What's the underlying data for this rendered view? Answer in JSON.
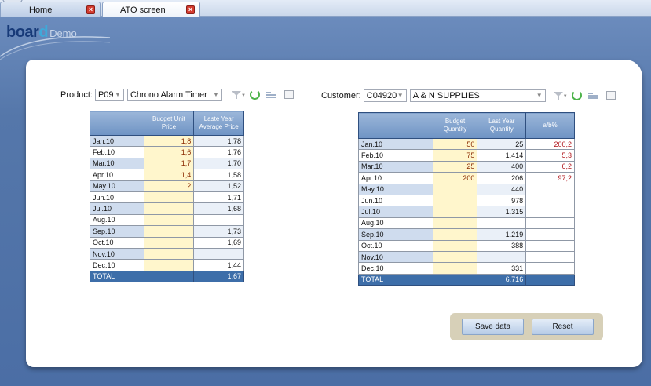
{
  "tabs": [
    {
      "label": "Home",
      "active": false
    },
    {
      "label": "ATO screen",
      "active": true
    }
  ],
  "logo": {
    "brand": "boar",
    "brand_end": "d",
    "suffix": "Demo"
  },
  "product_filter": {
    "label": "Product:",
    "code": "P09",
    "name": "Chrono Alarm Timer"
  },
  "customer_filter": {
    "label": "Customer:",
    "code": "C04920",
    "name": "A & N SUPPLIES"
  },
  "product_table": {
    "headers": [
      "",
      "Budget Unit Price",
      "Laste Year Average Price"
    ],
    "rows": [
      {
        "month": "Jan.10",
        "budget": "1,8",
        "last": "1,78"
      },
      {
        "month": "Feb.10",
        "budget": "1,6",
        "last": "1,76"
      },
      {
        "month": "Mar.10",
        "budget": "1,7",
        "last": "1,70"
      },
      {
        "month": "Apr.10",
        "budget": "1,4",
        "last": "1,58"
      },
      {
        "month": "May.10",
        "budget": "2",
        "last": "1,52"
      },
      {
        "month": "Jun.10",
        "budget": "",
        "last": "1,71"
      },
      {
        "month": "Jul.10",
        "budget": "",
        "last": "1,68"
      },
      {
        "month": "Aug.10",
        "budget": "",
        "last": ""
      },
      {
        "month": "Sep.10",
        "budget": "",
        "last": "1,73"
      },
      {
        "month": "Oct.10",
        "budget": "",
        "last": "1,69"
      },
      {
        "month": "Nov.10",
        "budget": "",
        "last": ""
      },
      {
        "month": "Dec.10",
        "budget": "",
        "last": "1,44"
      }
    ],
    "total": {
      "label": "TOTAL",
      "budget": "",
      "last": "1,67"
    }
  },
  "customer_table": {
    "headers": [
      "",
      "Budget Quantity",
      "Last Year Quantity",
      "a/b%"
    ],
    "rows": [
      {
        "month": "Jan.10",
        "budget": "50",
        "last": "25",
        "pct": "200,2"
      },
      {
        "month": "Feb.10",
        "budget": "75",
        "last": "1.414",
        "pct": "5,3"
      },
      {
        "month": "Mar.10",
        "budget": "25",
        "last": "400",
        "pct": "6,2"
      },
      {
        "month": "Apr.10",
        "budget": "200",
        "last": "206",
        "pct": "97,2"
      },
      {
        "month": "May.10",
        "budget": "",
        "last": "440",
        "pct": ""
      },
      {
        "month": "Jun.10",
        "budget": "",
        "last": "978",
        "pct": ""
      },
      {
        "month": "Jul.10",
        "budget": "",
        "last": "1.315",
        "pct": ""
      },
      {
        "month": "Aug.10",
        "budget": "",
        "last": "",
        "pct": ""
      },
      {
        "month": "Sep.10",
        "budget": "",
        "last": "1.219",
        "pct": ""
      },
      {
        "month": "Oct.10",
        "budget": "",
        "last": "388",
        "pct": ""
      },
      {
        "month": "Nov.10",
        "budget": "",
        "last": "",
        "pct": ""
      },
      {
        "month": "Dec.10",
        "budget": "",
        "last": "331",
        "pct": ""
      }
    ],
    "total": {
      "label": "TOTAL",
      "budget": "",
      "last": "6.716",
      "pct": ""
    }
  },
  "buttons": {
    "save": "Save data",
    "reset": "Reset"
  },
  "icons": {
    "filter": "filter-icon",
    "refresh": "refresh-icon",
    "slice": "slice-icon",
    "edit": "edit-icon"
  },
  "colors": {
    "header_blue": "#6e93c4",
    "total_blue": "#3d6ea9",
    "budget_cell": "#fff6cc",
    "negative_red": "#b0141a"
  }
}
